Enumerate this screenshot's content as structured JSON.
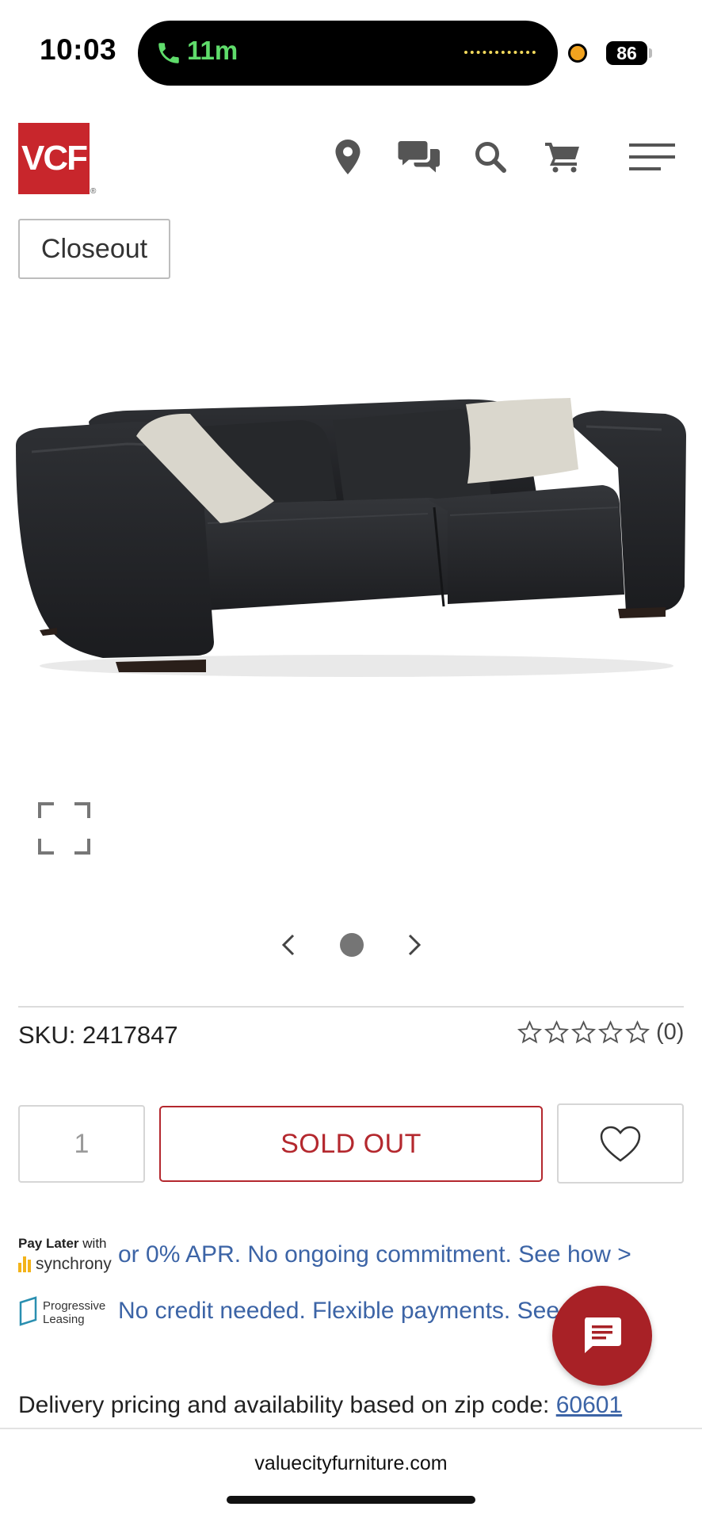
{
  "status_bar": {
    "time": "10:03",
    "call_duration": "11m",
    "battery": "86"
  },
  "header": {
    "logo_text": "VCF",
    "logo_registered": "®",
    "icons": [
      "location-pin-icon",
      "chat-bubbles-icon",
      "search-icon",
      "cart-icon",
      "hamburger-menu-icon"
    ]
  },
  "product": {
    "badge": "Closeout",
    "sku": "SKU: 2417847",
    "rating": 0,
    "review_count": "(0)",
    "quantity": "1",
    "button_label": "SOLD OUT",
    "carousel": {
      "current": 1,
      "total": 1
    }
  },
  "financing": {
    "synchrony_title": "Pay Later",
    "synchrony_with": "with",
    "synchrony_brand": "synchrony",
    "synchrony_text": "or 0% APR. No ongoing commitment. See how >",
    "progressive_brand_line1": "Progressive",
    "progressive_brand_line2": "Leasing",
    "progressive_text": "No credit needed. Flexible payments. See how >"
  },
  "delivery": {
    "text": "Delivery pricing and availability based on zip code:",
    "zip": "60601"
  },
  "browser": {
    "url": "valuecityfurniture.com"
  },
  "colors": {
    "brand_red": "#c8262c",
    "sold_out": "#b4282e",
    "link_blue": "#3c64a6",
    "chat_red": "#a82126"
  }
}
